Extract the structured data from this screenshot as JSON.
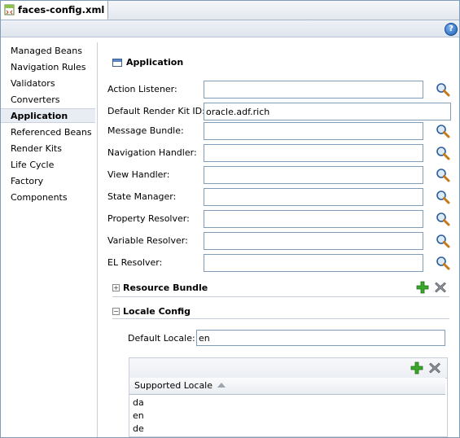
{
  "tab": {
    "title": "faces-config.xml"
  },
  "nav": {
    "items": [
      {
        "label": "Managed Beans"
      },
      {
        "label": "Navigation Rules"
      },
      {
        "label": "Validators"
      },
      {
        "label": "Converters"
      },
      {
        "label": "Application"
      },
      {
        "label": "Referenced Beans"
      },
      {
        "label": "Render Kits"
      },
      {
        "label": "Life Cycle"
      },
      {
        "label": "Factory"
      },
      {
        "label": "Components"
      }
    ],
    "selected": "Application"
  },
  "main": {
    "title": "Application",
    "fields": [
      {
        "label": "Action Listener:",
        "value": ""
      },
      {
        "label": "Default Render Kit ID:",
        "value": "oracle.adf.rich"
      },
      {
        "label": "Message Bundle:",
        "value": ""
      },
      {
        "label": "Navigation Handler:",
        "value": ""
      },
      {
        "label": "View Handler:",
        "value": ""
      },
      {
        "label": "State Manager:",
        "value": ""
      },
      {
        "label": "Property Resolver:",
        "value": ""
      },
      {
        "label": "Variable Resolver:",
        "value": ""
      },
      {
        "label": "EL Resolver:",
        "value": ""
      }
    ],
    "resource_bundle": {
      "title": "Resource Bundle",
      "expanded": false,
      "toggle": "+"
    },
    "locale_config": {
      "title": "Locale Config",
      "expanded": true,
      "toggle": "−",
      "default_locale_label": "Default Locale:",
      "default_locale_value": "en",
      "table_header": "Supported Locale",
      "rows": [
        "da",
        "en",
        "de"
      ]
    }
  },
  "icons": {
    "file": "xml-file-icon",
    "help": "help-icon",
    "browse": "magnifier-icon",
    "add": "add-icon",
    "delete": "delete-icon"
  },
  "colors": {
    "accent": "#1a5fb4",
    "add": "#2f9e1f",
    "delete": "#6b6b6b",
    "border": "#7f9db9"
  }
}
